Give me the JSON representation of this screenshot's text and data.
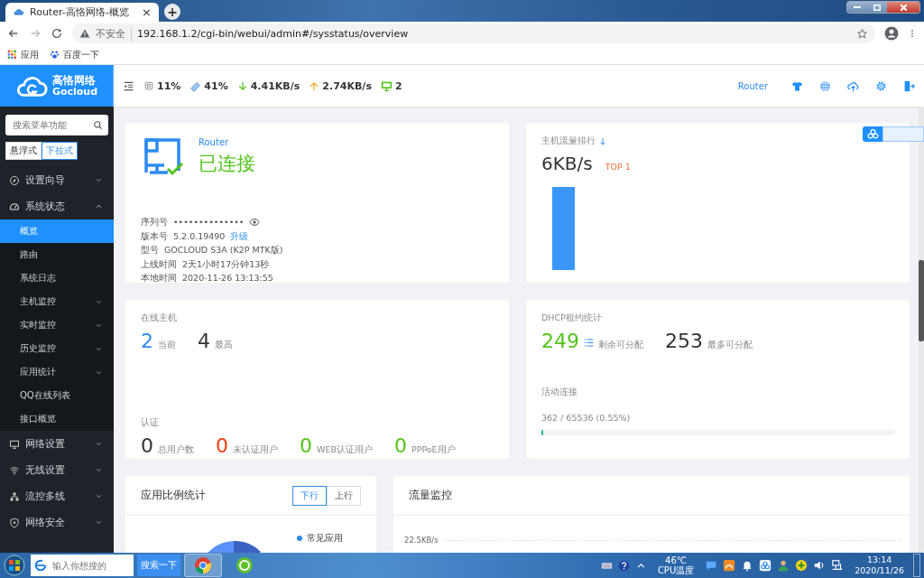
{
  "browser": {
    "tab_title": "Router-高恪网络-概览",
    "tab_close": "×",
    "new_tab": "+",
    "security": "不安全",
    "url": "192.168.1.2/cgi-bin/webui/admin#/sysstatus/overview",
    "bookmarks": [
      {
        "label": "应用",
        "kind": "apps"
      },
      {
        "label": "百度一下",
        "kind": "paw"
      }
    ]
  },
  "brand": {
    "name": "高恪网络",
    "name_en": "Gocloud"
  },
  "header": {
    "cpu": "11%",
    "memory": "41%",
    "download": "4.41KB/s",
    "upload": "2.74KB/s",
    "hosts": "2",
    "device": "Router"
  },
  "sidebar": {
    "search_placeholder": "搜索菜单功能",
    "modes": [
      {
        "label": "悬浮式",
        "selected": false
      },
      {
        "label": "下拉式",
        "selected": true
      }
    ],
    "items": [
      {
        "label": "设置向导",
        "kind": "compass",
        "expanded": false
      },
      {
        "label": "系统状态",
        "kind": "gauge",
        "expanded": true,
        "children": [
          {
            "label": "概览",
            "kind": "link",
            "selected": true
          },
          {
            "label": "路由",
            "kind": "link",
            "selected": false
          },
          {
            "label": "系统日志",
            "kind": "link",
            "selected": false
          },
          {
            "label": "主机监控",
            "kind": "group",
            "selected": false,
            "expanded": false
          },
          {
            "label": "实时监控",
            "kind": "group",
            "selected": false,
            "expanded": false
          },
          {
            "label": "历史监控",
            "kind": "group",
            "selected": false,
            "expanded": false
          },
          {
            "label": "应用统计",
            "kind": "group",
            "selected": false,
            "expanded": false
          },
          {
            "label": "QQ在线列表",
            "kind": "link",
            "selected": false
          },
          {
            "label": "接口概览",
            "kind": "link",
            "selected": false
          }
        ]
      },
      {
        "label": "网络设置",
        "kind": "monitor",
        "expanded": false
      },
      {
        "label": "无线设置",
        "kind": "wifi",
        "expanded": false
      },
      {
        "label": "流控多线",
        "kind": "flow",
        "expanded": false
      },
      {
        "label": "网络安全",
        "kind": "shield",
        "expanded": false
      }
    ]
  },
  "connection": {
    "device": "Router",
    "status": "已连接",
    "connected": true,
    "info": [
      {
        "label": "序列号",
        "value": "••••••••••••••",
        "kind": "secret"
      },
      {
        "label": "版本号",
        "value": "5.2.0.19490",
        "kind": "upgrade",
        "link": "升级"
      },
      {
        "label": "型号",
        "value": "GOCLOUD S3A (K2P MTK版)",
        "kind": "plain"
      },
      {
        "label": "上线时间",
        "value": "2天1小时17分钟13秒",
        "kind": "plain"
      },
      {
        "label": "本地时间",
        "value": "2020-11-26 13:13:55",
        "kind": "plain"
      }
    ]
  },
  "ranking": {
    "title": "主机流量排行",
    "value": "6KB/s",
    "rank": "TOP 1"
  },
  "hosts": {
    "title": "在线主机",
    "stats": [
      {
        "value": "2",
        "label": "当前",
        "color": "#2d8cf0"
      },
      {
        "value": "4",
        "label": "最高",
        "color": "#333333"
      }
    ]
  },
  "auth": {
    "title": "认证",
    "stats": [
      {
        "value": "0",
        "label": "总用户数",
        "color": "#333333"
      },
      {
        "value": "0",
        "label": "未认证用户",
        "color": "#ed4014"
      },
      {
        "value": "0",
        "label": "WEB认证用户",
        "color": "#52c41a"
      },
      {
        "value": "0",
        "label": "PPPoE用户",
        "color": "#52c41a"
      }
    ]
  },
  "dhcp": {
    "title": "DHCP租约统计",
    "stats": [
      {
        "value": "249",
        "label": "剩余可分配",
        "color": "#52c41a",
        "kind": "list"
      },
      {
        "value": "253",
        "label": "最多可分配",
        "color": "#333333",
        "kind": "plain"
      }
    ]
  },
  "connections": {
    "title": "活动连接",
    "reading": "362 / 65536 (0.55%)",
    "level": 0.0055
  },
  "app_ratio": {
    "title": "应用比例统计",
    "directions": [
      {
        "label": "下行",
        "selected": true
      },
      {
        "label": "上行",
        "selected": false
      }
    ],
    "legend": [
      {
        "label": "常见应用",
        "color": "#2d8cf0"
      }
    ]
  },
  "traffic": {
    "title": "流量监控",
    "y_label": "22.5KB/s"
  },
  "taskbar": {
    "search_placeholder": "输入你想搜的",
    "search_button": "搜索一下",
    "temperature": "46℃",
    "temperature_label": "CPU温度",
    "time": "13:14",
    "date": "2020/11/26"
  }
}
